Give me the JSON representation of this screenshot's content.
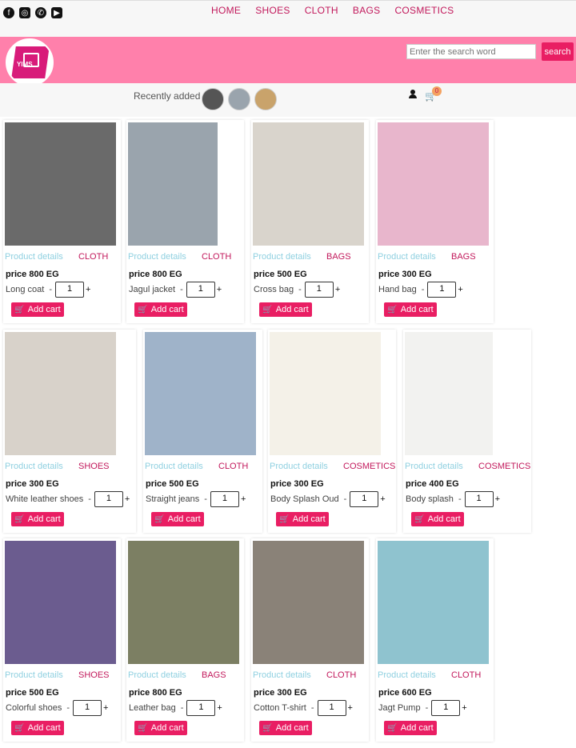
{
  "nav": [
    "HOME",
    "SHOES",
    "CLOTH",
    "BAGS",
    "COSMETICS"
  ],
  "social_icons": [
    "facebook-icon",
    "instagram-icon",
    "whatsapp-icon",
    "youtube-icon"
  ],
  "logo_text": "YIMS",
  "search": {
    "placeholder": "Enter the search word",
    "button": "search"
  },
  "recent": {
    "label": "Recently added"
  },
  "cart": {
    "count": "0"
  },
  "products": [
    {
      "details": "Product details",
      "category": "CLOTH",
      "price": "price 800 EG",
      "name": "Long coat",
      "qty": "1",
      "button": "Add cart",
      "img": "#6a6a6a"
    },
    {
      "details": "Product details",
      "category": "CLOTH",
      "price": "price 800 EG",
      "name": "Jagul jacket",
      "qty": "1",
      "button": "Add cart",
      "img": "#9aa4ad"
    },
    {
      "details": "Product details",
      "category": "BAGS",
      "price": "price 500 EG",
      "name": "Cross bag",
      "qty": "1",
      "button": "Add cart",
      "img": "#d9d4cc"
    },
    {
      "details": "Product details",
      "category": "BAGS",
      "price": "price 300 EG",
      "name": "Hand bag",
      "qty": "1",
      "button": "Add cart",
      "img": "#e8b6cc"
    },
    {
      "details": "Product details",
      "category": "SHOES",
      "price": "price 300 EG",
      "name": "White leather shoes",
      "qty": "1",
      "button": "Add cart",
      "img": "#d8d2ca"
    },
    {
      "details": "Product details",
      "category": "CLOTH",
      "price": "price 500 EG",
      "name": "Straight jeans",
      "qty": "1",
      "button": "Add cart",
      "img": "#9fb3c9"
    },
    {
      "details": "Product details",
      "category": "COSMETICS",
      "price": "price 300 EG",
      "name": "Body Splash Oud",
      "qty": "1",
      "button": "Add cart",
      "img": "#f4f1e8"
    },
    {
      "details": "Product details",
      "category": "COSMETICS",
      "price": "price 400 EG",
      "name": "Body splash",
      "qty": "1",
      "button": "Add cart",
      "img": "#f2f2f0"
    },
    {
      "details": "Product details",
      "category": "SHOES",
      "price": "price 500 EG",
      "name": "Colorful shoes",
      "qty": "1",
      "button": "Add cart",
      "img": "#6b5c8f"
    },
    {
      "details": "Product details",
      "category": "BAGS",
      "price": "price 800 EG",
      "name": "Leather bag",
      "qty": "1",
      "button": "Add cart",
      "img": "#7c7f63"
    },
    {
      "details": "Product details",
      "category": "CLOTH",
      "price": "price 300 EG",
      "name": "Cotton T-shirt",
      "qty": "1",
      "button": "Add cart",
      "img": "#8a8278"
    },
    {
      "details": "Product details",
      "category": "CLOTH",
      "price": "price 600 EG",
      "name": "Jagt Pump",
      "qty": "1",
      "button": "Add cart",
      "img": "#8fc3cf"
    }
  ]
}
